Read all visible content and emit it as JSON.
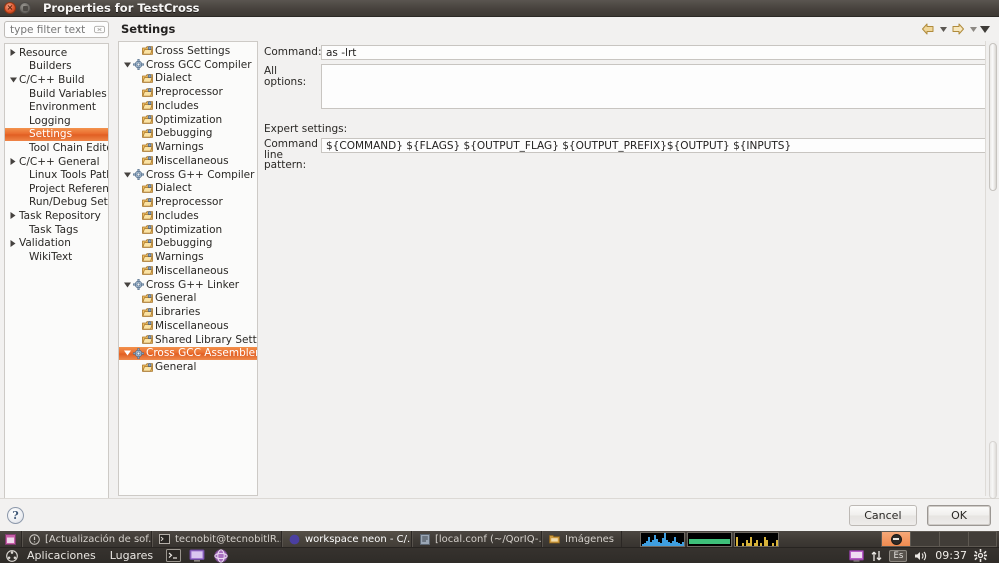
{
  "window": {
    "title": "Properties for TestCross",
    "close_icon": "window-close-icon",
    "minmax_icon": "window-maximize-icon"
  },
  "filter": {
    "placeholder": "type filter text",
    "clear_icon": "clear-field-icon"
  },
  "left_tree": [
    {
      "label": "Resource",
      "indent": 0,
      "arrow": "collapsed"
    },
    {
      "label": "Builders",
      "indent": 1,
      "arrow": "none"
    },
    {
      "label": "C/C++ Build",
      "indent": 0,
      "arrow": "expanded"
    },
    {
      "label": "Build Variables",
      "indent": 1,
      "arrow": "none"
    },
    {
      "label": "Environment",
      "indent": 1,
      "arrow": "none"
    },
    {
      "label": "Logging",
      "indent": 1,
      "arrow": "none"
    },
    {
      "label": "Settings",
      "indent": 1,
      "arrow": "none",
      "selected": true
    },
    {
      "label": "Tool Chain Editor",
      "indent": 1,
      "arrow": "none"
    },
    {
      "label": "C/C++ General",
      "indent": 0,
      "arrow": "collapsed"
    },
    {
      "label": "Linux Tools Path",
      "indent": 1,
      "arrow": "none"
    },
    {
      "label": "Project References",
      "indent": 1,
      "arrow": "none"
    },
    {
      "label": "Run/Debug Settings",
      "indent": 1,
      "arrow": "none"
    },
    {
      "label": "Task Repository",
      "indent": 0,
      "arrow": "collapsed"
    },
    {
      "label": "Task Tags",
      "indent": 1,
      "arrow": "none"
    },
    {
      "label": "Validation",
      "indent": 0,
      "arrow": "collapsed"
    },
    {
      "label": "WikiText",
      "indent": 1,
      "arrow": "none"
    }
  ],
  "page": {
    "title": "Settings",
    "nav": {
      "back_icon": "back-arrow-icon",
      "back_menu_icon": "chevron-down-icon",
      "forward_icon": "forward-arrow-icon",
      "forward_menu_icon": "chevron-down-icon",
      "view_menu_icon": "view-menu-icon"
    }
  },
  "center_tree": [
    {
      "label": "Cross Settings",
      "indent": 1,
      "arrow": "none",
      "icon": "tool-icon"
    },
    {
      "label": "Cross GCC Compiler",
      "indent": 0,
      "arrow": "expanded",
      "icon": "gear-icon"
    },
    {
      "label": "Dialect",
      "indent": 1,
      "arrow": "none",
      "icon": "tool-icon"
    },
    {
      "label": "Preprocessor",
      "indent": 1,
      "arrow": "none",
      "icon": "tool-icon"
    },
    {
      "label": "Includes",
      "indent": 1,
      "arrow": "none",
      "icon": "tool-icon"
    },
    {
      "label": "Optimization",
      "indent": 1,
      "arrow": "none",
      "icon": "tool-icon"
    },
    {
      "label": "Debugging",
      "indent": 1,
      "arrow": "none",
      "icon": "tool-icon"
    },
    {
      "label": "Warnings",
      "indent": 1,
      "arrow": "none",
      "icon": "tool-icon"
    },
    {
      "label": "Miscellaneous",
      "indent": 1,
      "arrow": "none",
      "icon": "tool-icon"
    },
    {
      "label": "Cross G++ Compiler",
      "indent": 0,
      "arrow": "expanded",
      "icon": "gear-icon"
    },
    {
      "label": "Dialect",
      "indent": 1,
      "arrow": "none",
      "icon": "tool-icon"
    },
    {
      "label": "Preprocessor",
      "indent": 1,
      "arrow": "none",
      "icon": "tool-icon"
    },
    {
      "label": "Includes",
      "indent": 1,
      "arrow": "none",
      "icon": "tool-icon"
    },
    {
      "label": "Optimization",
      "indent": 1,
      "arrow": "none",
      "icon": "tool-icon"
    },
    {
      "label": "Debugging",
      "indent": 1,
      "arrow": "none",
      "icon": "tool-icon"
    },
    {
      "label": "Warnings",
      "indent": 1,
      "arrow": "none",
      "icon": "tool-icon"
    },
    {
      "label": "Miscellaneous",
      "indent": 1,
      "arrow": "none",
      "icon": "tool-icon"
    },
    {
      "label": "Cross G++ Linker",
      "indent": 0,
      "arrow": "expanded",
      "icon": "gear-icon"
    },
    {
      "label": "General",
      "indent": 1,
      "arrow": "none",
      "icon": "tool-icon"
    },
    {
      "label": "Libraries",
      "indent": 1,
      "arrow": "none",
      "icon": "tool-icon"
    },
    {
      "label": "Miscellaneous",
      "indent": 1,
      "arrow": "none",
      "icon": "tool-icon"
    },
    {
      "label": "Shared Library Settings",
      "indent": 1,
      "arrow": "none",
      "icon": "tool-icon"
    },
    {
      "label": "Cross GCC Assembler",
      "indent": 0,
      "arrow": "expanded",
      "icon": "gear-icon",
      "selected": true
    },
    {
      "label": "General",
      "indent": 1,
      "arrow": "none",
      "icon": "tool-icon"
    }
  ],
  "form": {
    "command_label": "Command:",
    "command_value": "as -lrt",
    "all_options_label": "All options:",
    "all_options_value": "",
    "expert_label": "Expert settings:",
    "pattern_label_line1": "Command",
    "pattern_label_line2": "line pattern:",
    "pattern_value": "${COMMAND} ${FLAGS} ${OUTPUT_FLAG} ${OUTPUT_PREFIX}${OUTPUT} ${INPUTS}"
  },
  "buttons": {
    "help": "?",
    "cancel": "Cancel",
    "ok": "OK"
  },
  "taskbar": {
    "show_desktop_icon": "show-desktop-icon",
    "windows": [
      {
        "label": "[Actualización de sof...",
        "icon": "update-manager-icon",
        "active": false
      },
      {
        "label": "tecnobit@tecnobitlR...",
        "icon": "terminal-icon",
        "active": false
      },
      {
        "label": "workspace  neon - C/...",
        "icon": "eclipse-icon",
        "active": true
      },
      {
        "label": "[local.conf (~/QorIQ-...",
        "icon": "text-editor-icon",
        "active": false
      },
      {
        "label": "Imágenes",
        "icon": "folder-icon",
        "active": false
      }
    ],
    "monitors": [
      {
        "name": "cpu-monitor",
        "color": "#3f9fe0"
      },
      {
        "name": "memory-monitor",
        "color": "#3ec07a"
      },
      {
        "name": "network-monitor",
        "color": "#d8b33a"
      }
    ],
    "workspaces": [
      {
        "name": "workspace-1",
        "active": true
      },
      {
        "name": "workspace-2",
        "active": false
      },
      {
        "name": "workspace-3",
        "active": false
      },
      {
        "name": "workspace-4",
        "active": false
      }
    ],
    "menus": [
      "Aplicaciones",
      "Lugares"
    ],
    "app_menu_icon": "ubuntu-logo-icon",
    "launchers": [
      {
        "name": "terminal-launcher"
      },
      {
        "name": "remote-desktop-launcher"
      },
      {
        "name": "browser-launcher"
      }
    ],
    "tray": {
      "display_icon": "display-icon",
      "network_icon": "network-updown-icon",
      "language": "Es",
      "volume_icon": "volume-icon",
      "clock": "09:37",
      "settings_icon": "gear-icon"
    }
  },
  "colors": {
    "selection_orange": "#e9692c",
    "titlebar_dark": "#47423d",
    "panel_bg": "#f2f1f0",
    "tree_bg": "#fbfbfa",
    "taskbar_bg": "#37332f"
  }
}
